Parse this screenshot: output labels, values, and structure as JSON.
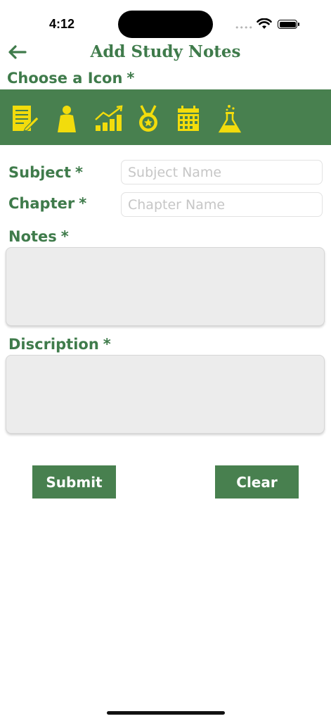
{
  "status_bar": {
    "time": "4:12",
    "dots": "••••"
  },
  "header": {
    "title": "Add Study Notes"
  },
  "icon_section": {
    "label": "Choose a Icon",
    "required": "*",
    "icons": [
      "notes-icon",
      "person-icon",
      "growth-chart-icon",
      "medal-icon",
      "calendar-icon",
      "lab-flask-icon"
    ],
    "band_color": "#48804f",
    "icon_color": "#f2dc0c"
  },
  "form": {
    "subject": {
      "label": "Subject",
      "required": "*",
      "placeholder": "Subject Name",
      "value": ""
    },
    "chapter": {
      "label": "Chapter",
      "required": "*",
      "placeholder": "Chapter Name",
      "value": ""
    },
    "notes": {
      "label": "Notes",
      "required": "*",
      "value": ""
    },
    "description": {
      "label": "Discription",
      "required": "*",
      "value": ""
    }
  },
  "actions": {
    "submit_label": "Submit",
    "clear_label": "Clear"
  },
  "colors": {
    "accent": "#3f7b4b"
  }
}
